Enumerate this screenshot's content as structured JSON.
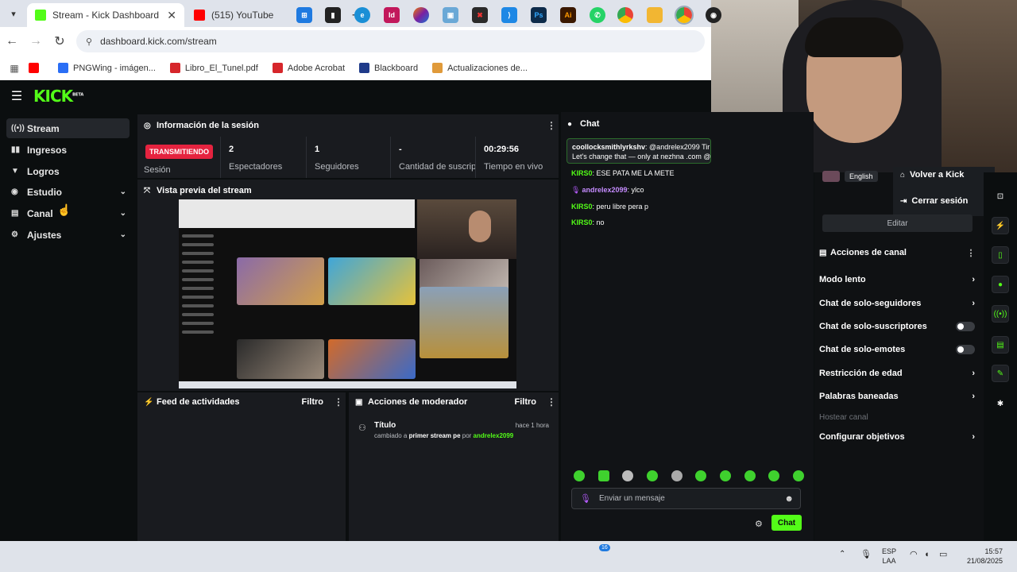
{
  "browser": {
    "tabs": [
      {
        "title": "Stream - Kick Dashboard",
        "active": true,
        "favicon_color": "#53fc18"
      },
      {
        "title": "(515) YouTube",
        "active": false,
        "favicon_color": "#ff0000"
      }
    ],
    "close_glyph": "✕",
    "new_tab_glyph": "+",
    "url": "dashboard.kick.com/stream",
    "bookmarks": [
      {
        "label": "PNGWing - imágen...",
        "color": "#2a6ef5"
      },
      {
        "label": "Libro_El_Tunel.pdf",
        "color": "#d6262b"
      },
      {
        "label": "Adobe Acrobat",
        "color": "#d6262b"
      },
      {
        "label": "Blackboard",
        "color": "#1f3b8a"
      },
      {
        "label": "Actualizaciones de...",
        "color": "#e09a3a"
      }
    ]
  },
  "kick": {
    "logo": "KICK",
    "logo_tag": "BETA",
    "accent": "#53fc18",
    "sidebar": [
      {
        "label": "Stream",
        "icon": "radio-icon",
        "glyph": "((•))",
        "active": true,
        "expandable": false
      },
      {
        "label": "Ingresos",
        "icon": "chart-icon",
        "glyph": "▮▮",
        "active": false,
        "expandable": false
      },
      {
        "label": "Logros",
        "icon": "trophy-icon",
        "glyph": "🏆",
        "active": false,
        "expandable": false
      },
      {
        "label": "Estudio",
        "icon": "studio-icon",
        "glyph": "◉",
        "active": false,
        "expandable": true
      },
      {
        "label": "Canal",
        "icon": "channel-icon",
        "glyph": "▤",
        "active": false,
        "expandable": true
      },
      {
        "label": "Ajustes",
        "icon": "gear-icon",
        "glyph": "⚙",
        "active": false,
        "expandable": true
      }
    ],
    "session": {
      "title": "Información de la sesión",
      "badge": "TRANSMITIENDO",
      "badge_label": "Sesión",
      "stats": [
        {
          "value": "2",
          "label": "Espectadores"
        },
        {
          "value": "1",
          "label": "Seguidores"
        },
        {
          "value": "-",
          "label": "Cantidad de suscripciones"
        },
        {
          "value": "00:29:56",
          "label": "Tiempo en vivo"
        }
      ]
    },
    "preview": {
      "title": "Vista previa del stream"
    },
    "feed": {
      "title": "Feed de actividades",
      "filter": "Filtro"
    },
    "mod": {
      "title": "Acciones de moderador",
      "filter": "Filtro",
      "entry": {
        "title": "Título",
        "time": "hace 1 hora",
        "text_a": "cambiado a ",
        "text_b": "primer stream pe",
        "text_c": " por ",
        "user": "andrelex2099"
      }
    },
    "chat": {
      "title": "Chat",
      "pinned": {
        "user": "coollocksmithlyrkshv",
        "line1": ": @andrelex2099 Tir",
        "line2": "Let's change that — only at nezhna .com @"
      },
      "messages": [
        {
          "user": "KIRS0",
          "text": ": ESE PATA ME LA METE",
          "color": "#53fc18"
        },
        {
          "user": "andrelex2099",
          "text": ": ylco",
          "color": "#c58cff"
        },
        {
          "user": "KIRS0",
          "text": ": peru libre pera p",
          "color": "#53fc18"
        },
        {
          "user": "KIRS0",
          "text": ": no",
          "color": "#53fc18"
        }
      ],
      "input_placeholder": "Enviar un mensaje",
      "send": "Chat"
    },
    "profile_menu": {
      "language": "English",
      "items": [
        {
          "label": "Volver a Kick",
          "icon": "home-icon",
          "glyph": "⌂"
        },
        {
          "label": "Cerrar sesión",
          "icon": "logout-icon",
          "glyph": "⇥"
        }
      ],
      "edit": "Editar"
    },
    "channel_actions": {
      "title": "Acciones de canal",
      "rows": [
        {
          "label": "Modo lento",
          "control": "arrow"
        },
        {
          "label": "Chat de solo-seguidores",
          "control": "arrow"
        },
        {
          "label": "Chat de solo-suscriptores",
          "control": "toggle"
        },
        {
          "label": "Chat de solo-emotes",
          "control": "toggle"
        },
        {
          "label": "Restricción de edad",
          "control": "arrow"
        },
        {
          "label": "Palabras baneadas",
          "control": "arrow"
        },
        {
          "label": "Hostear canal",
          "control": "none",
          "disabled": true
        },
        {
          "label": "Configurar objetivos",
          "control": "arrow"
        }
      ]
    }
  },
  "taskbar": {
    "language": "ESP",
    "layout": "LAA",
    "time": "15:57",
    "date": "21/08/2025",
    "whatsapp_badge": "16"
  }
}
